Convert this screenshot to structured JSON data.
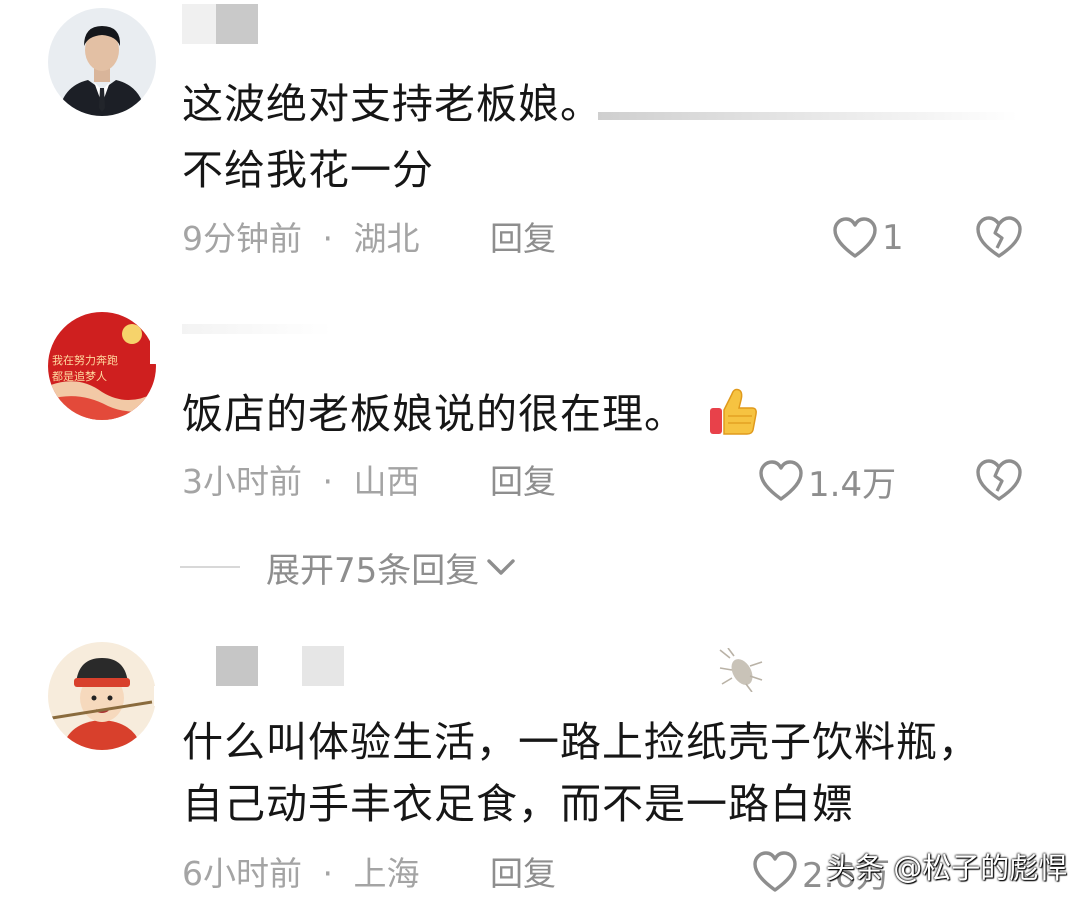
{
  "comments": [
    {
      "text_lines": [
        "这波绝对支持老板娘。",
        "不给我花一分"
      ],
      "time": "9分钟前",
      "separator": "·",
      "location": "湖北",
      "reply_label": "回复",
      "likes": "1",
      "avatar_icon": "man-in-suit-avatar"
    },
    {
      "text_lines": [
        "饭店的老板娘说的很在理。"
      ],
      "emoji_icon": "thumbs-up-icon",
      "time": "3小时前",
      "separator": "·",
      "location": "山西",
      "reply_label": "回复",
      "likes": "1.4万",
      "avatar_icon": "red-banner-avatar",
      "avatar_caption_1": "我在努力奔跑",
      "avatar_caption_2": "都是追梦人",
      "expand_label": "展开75条回复"
    },
    {
      "text_lines": [
        "什么叫体验生活，一路上捡纸壳子饮料瓶，",
        "自己动手丰衣足食，而不是一路白嫖"
      ],
      "time": "6小时前",
      "separator": "·",
      "location": "上海",
      "reply_label": "回复",
      "likes": "2.6万",
      "avatar_icon": "cartoon-official-avatar"
    }
  ],
  "watermark": "头条 @松子的彪悍",
  "colors": {
    "text": "#161616",
    "meta": "#a4a4a4",
    "action": "#8e8e8e"
  }
}
